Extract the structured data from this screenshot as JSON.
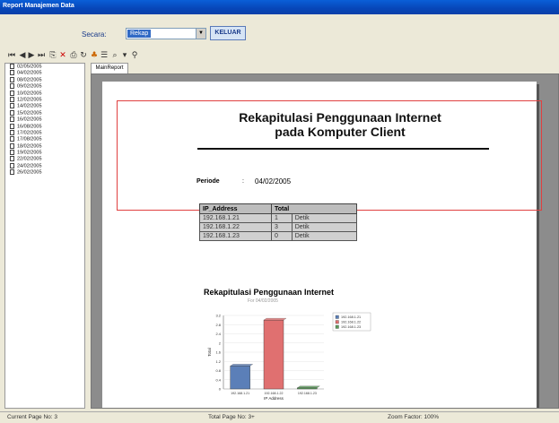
{
  "window": {
    "title": "Report Manajemen Data"
  },
  "filter": {
    "label": "Secara:",
    "selected_value": "Rekap",
    "exit_button": "KELUAR"
  },
  "tree": {
    "items": [
      "02/05/2005",
      "04/02/2005",
      "08/02/2005",
      "09/02/2005",
      "10/02/2005",
      "12/02/2005",
      "14/02/2005",
      "15/02/2005",
      "16/02/2005",
      "16/08/2005",
      "17/02/2005",
      "17/08/2005",
      "18/02/2005",
      "19/02/2005",
      "22/02/2005",
      "24/02/2005",
      "26/02/2005"
    ]
  },
  "tabs": {
    "main": "MainReport"
  },
  "report": {
    "title_line1": "Rekapitulasi Penggunaan Internet",
    "title_line2": "pada Komputer Client",
    "periode_label": "Periode",
    "periode_colon": ":",
    "periode_value": "04/02/2005",
    "table": {
      "headers": [
        "IP_Address",
        "Total",
        ""
      ],
      "rows": [
        [
          "192.168.1.21",
          "1",
          "Detik"
        ],
        [
          "192.168.1.22",
          "3",
          "Detik"
        ],
        [
          "192.168.1.23",
          "0",
          "Detik"
        ]
      ]
    }
  },
  "chart_data": {
    "type": "bar",
    "title": "Rekapitulasi Penggunaan Internet",
    "subtitle": "For 04/02/2005",
    "xlabel": "IP Address",
    "ylabel": "Total",
    "categories": [
      "192.168.1.21",
      "192.168.1.22",
      "192.168.1.23"
    ],
    "series": [
      {
        "name": "192.168.1.21",
        "values": [
          1,
          0,
          0
        ],
        "color": "#5b7fb8"
      },
      {
        "name": "192.168.1.22",
        "values": [
          0,
          3,
          0
        ],
        "color": "#e07070"
      },
      {
        "name": "192.168.1.23",
        "values": [
          0,
          0,
          0
        ],
        "color": "#5a9a5a"
      }
    ],
    "values": [
      1,
      3,
      0
    ],
    "ylim": [
      0,
      3.2
    ],
    "yticks": [
      "3.2",
      "2.8",
      "2.4",
      "2",
      "1.6",
      "1.2",
      "0.8",
      "0.4",
      "0"
    ],
    "legend_position": "right",
    "grid": true
  },
  "status": {
    "current_page": "Current Page No: 3",
    "total_page": "Total Page No: 3+",
    "zoom": "Zoom Factor: 100%"
  },
  "icons": [
    "first-page-icon",
    "prev-page-icon",
    "next-page-icon",
    "last-page-icon",
    "export-icon",
    "close-icon",
    "print-icon",
    "refresh-icon",
    "tree-toggle-icon",
    "group-tree-icon",
    "zoom-icon",
    "search-icon"
  ]
}
